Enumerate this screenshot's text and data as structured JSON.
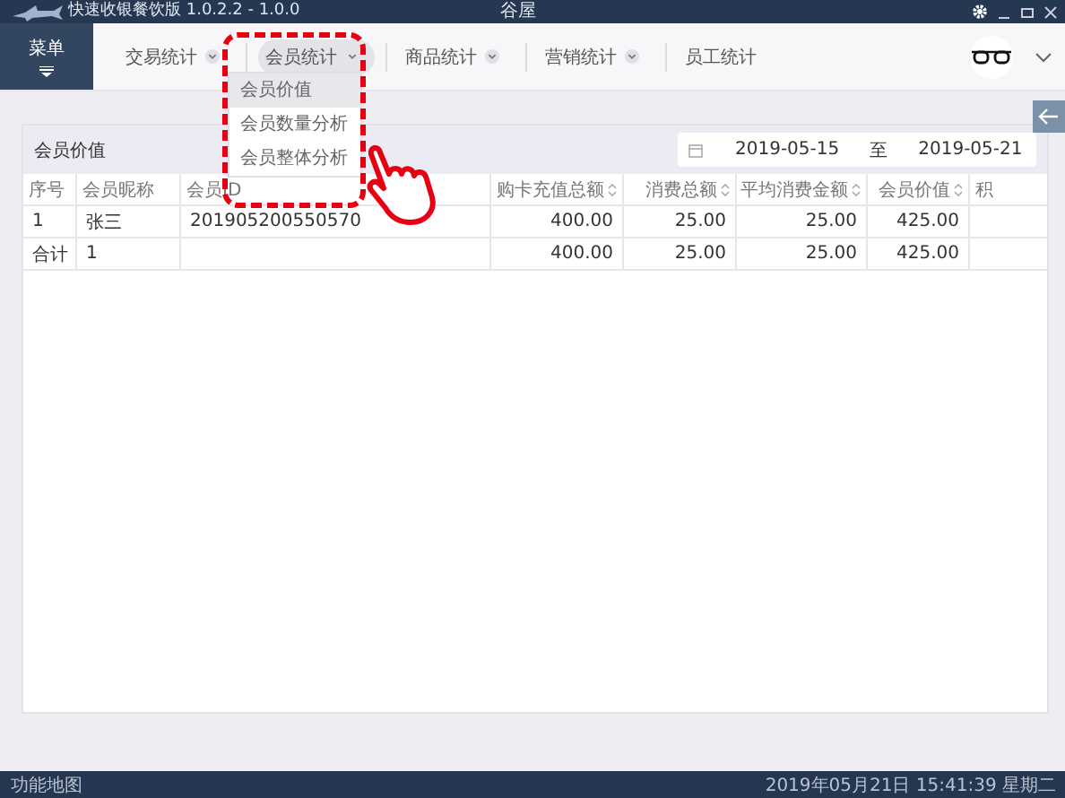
{
  "window": {
    "title": "快速收银餐饮版 1.0.2.2 - 1.0.0",
    "store": "谷屋"
  },
  "menu_button": {
    "label": "菜单"
  },
  "tabs": [
    {
      "label": "交易统计",
      "selected": false,
      "has_dropdown": true
    },
    {
      "label": "会员统计",
      "selected": true,
      "has_dropdown": true
    },
    {
      "label": "商品统计",
      "selected": false,
      "has_dropdown": true
    },
    {
      "label": "营销统计",
      "selected": false,
      "has_dropdown": true
    },
    {
      "label": "员工统计",
      "selected": false,
      "has_dropdown": false
    }
  ],
  "dropdown": {
    "items": [
      {
        "label": "会员价值",
        "selected": true
      },
      {
        "label": "会员数量分析",
        "selected": false
      },
      {
        "label": "会员整体分析",
        "selected": false
      }
    ]
  },
  "panel": {
    "title": "会员价值",
    "date_from": "2019-05-15",
    "date_sep": "至",
    "date_to": "2019-05-21"
  },
  "table": {
    "columns": [
      {
        "label": "序号",
        "sortable": false,
        "kind": "text"
      },
      {
        "label": "会员昵称",
        "sortable": false,
        "kind": "text"
      },
      {
        "label": "会员ID",
        "sortable": false,
        "kind": "text"
      },
      {
        "label": "购卡充值总额",
        "sortable": true,
        "kind": "amount"
      },
      {
        "label": "消费总额",
        "sortable": true,
        "kind": "amount"
      },
      {
        "label": "平均消费金额",
        "sortable": true,
        "kind": "amount"
      },
      {
        "label": "会员价值",
        "sortable": true,
        "kind": "amount"
      },
      {
        "label": "积",
        "sortable": false,
        "kind": "text"
      }
    ],
    "rows": [
      [
        "1",
        "张三",
        "201905200550570",
        "400.00",
        "25.00",
        "25.00",
        "425.00",
        ""
      ],
      [
        "合计",
        "1",
        "",
        "400.00",
        "25.00",
        "25.00",
        "425.00",
        ""
      ]
    ]
  },
  "status_bar": {
    "left": "功能地图",
    "right": "2019年05月21日 15:41:39 星期二"
  }
}
